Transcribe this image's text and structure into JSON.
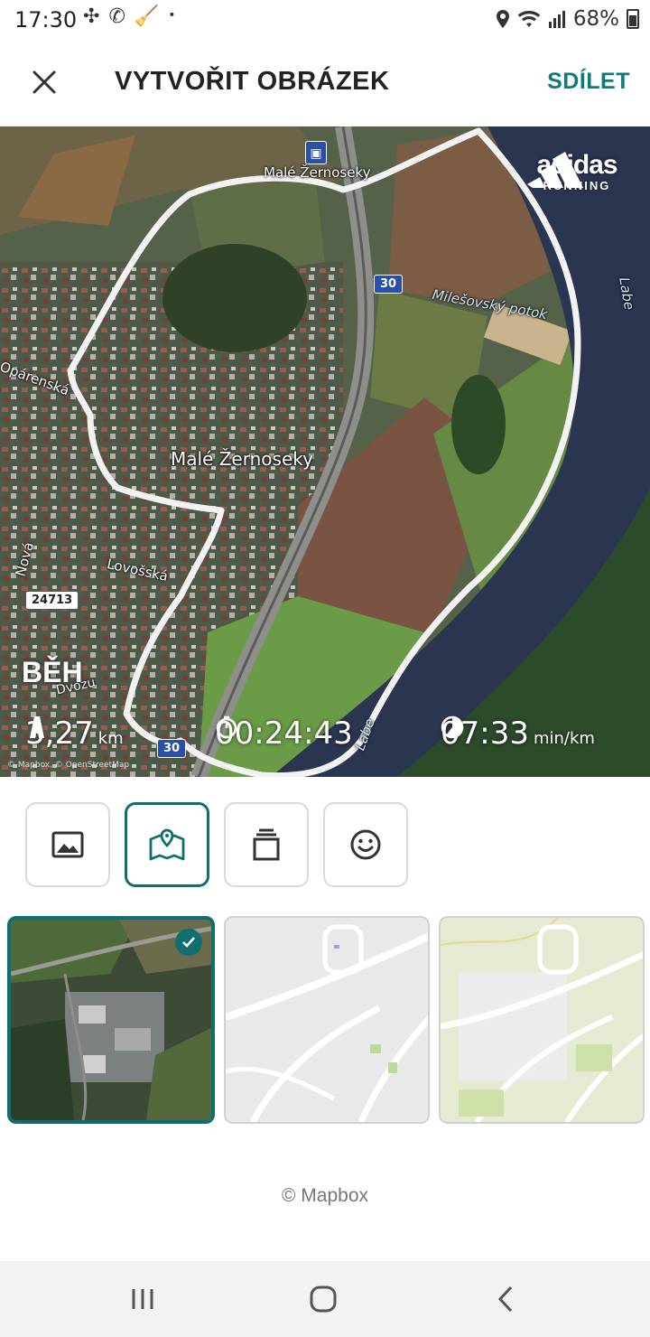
{
  "status_bar": {
    "time": "17:30",
    "battery": "68%",
    "left_icons": [
      "pinwheel-icon",
      "whatsapp-icon",
      "broom-icon",
      "dot-icon"
    ],
    "right_icons": [
      "location-icon",
      "wifi-icon",
      "signal-icon",
      "battery-icon"
    ]
  },
  "header": {
    "title": "VYTVOŘIT OBRÁZEK",
    "share_label": "SDÍLET",
    "close_icon": "close-icon"
  },
  "preview": {
    "brand_name": "adidas",
    "brand_sub": "RUNNING",
    "activity_type": "BĚH",
    "distance_value": "3,27",
    "distance_unit": "km",
    "duration_value": "00:24:43",
    "pace_value": "07:33",
    "pace_unit": "min/km",
    "attribution": "© Mapbox, © OpenStreetMap",
    "map_labels": {
      "town": "Malé Žernoseky",
      "town_top": "Malé Žernoseky",
      "stream": "Milešovský potok",
      "river": "Labe",
      "river_2": "Labe",
      "street_1": "Opárenská",
      "street_2": "Nová",
      "street_3": "Lovošská",
      "street_4": "Dvozu",
      "road_30": "30",
      "road_24713": "24713",
      "road_bottom": "30"
    }
  },
  "tools": [
    {
      "name": "image-icon",
      "active": false
    },
    {
      "name": "map-icon",
      "active": true
    },
    {
      "name": "layers-icon",
      "active": false
    },
    {
      "name": "smiley-icon",
      "active": false
    }
  ],
  "map_styles": [
    {
      "name": "satellite",
      "selected": true
    },
    {
      "name": "light-street",
      "selected": false
    },
    {
      "name": "outdoor-green",
      "selected": false
    }
  ],
  "credit": "© Mapbox",
  "colors": {
    "accent": "#0f6e6f",
    "share_text": "#0f7a78",
    "route": "#ffffff",
    "river": "#2a3550"
  }
}
